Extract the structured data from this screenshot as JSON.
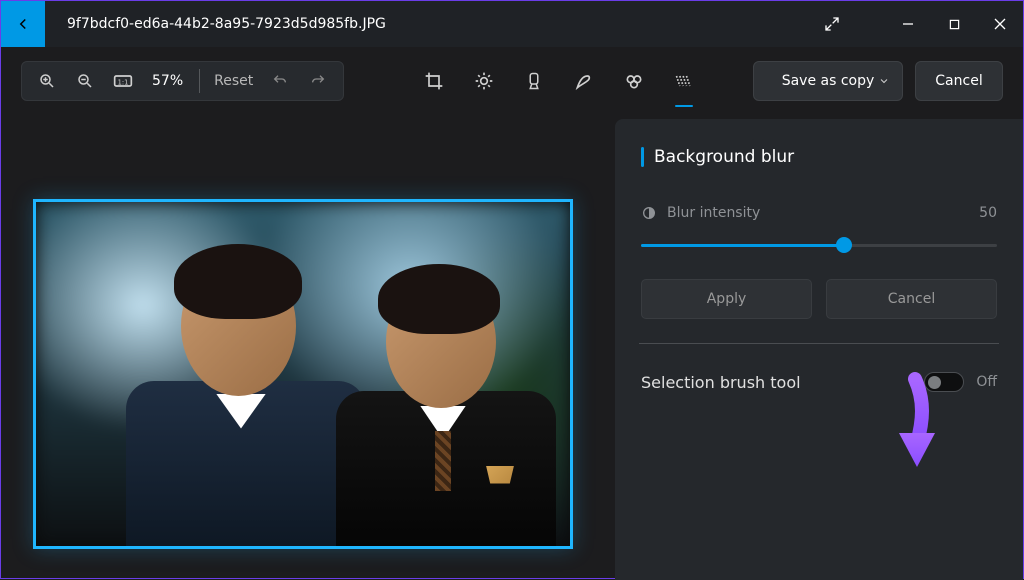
{
  "titlebar": {
    "filename": "9f7bdcf0-ed6a-44b2-8a95-7923d5d985fb.JPG"
  },
  "toolbar": {
    "zoom_pct": "57%",
    "reset_label": "Reset",
    "save_label": "Save as copy",
    "cancel_label": "Cancel"
  },
  "panel": {
    "title": "Background blur",
    "blur_intensity_label": "Blur intensity",
    "blur_intensity_value": "50",
    "slider_pct": 57,
    "apply_label": "Apply",
    "cancel_label": "Cancel",
    "brush_label": "Selection brush tool",
    "brush_state": "Off"
  },
  "icons": {
    "back": "back-arrow-icon",
    "expand": "expand-icon",
    "minimize": "minimize-icon",
    "maximize": "maximize-icon",
    "close": "close-icon",
    "zoom_in": "zoom-in-icon",
    "zoom_out": "zoom-out-icon",
    "fit": "fit-icon",
    "undo": "undo-icon",
    "redo": "redo-icon",
    "crop": "crop-icon",
    "adjust": "adjust-icon",
    "filter": "filter-icon",
    "markup": "markup-icon",
    "retouch": "retouch-icon",
    "bg_blur": "background-blur-icon",
    "chevron": "chevron-down-icon",
    "blur_small": "blur-small-icon"
  },
  "colors": {
    "accent": "#0099e5",
    "panel_bg": "#25282c",
    "arrow": "#8a4dff"
  }
}
